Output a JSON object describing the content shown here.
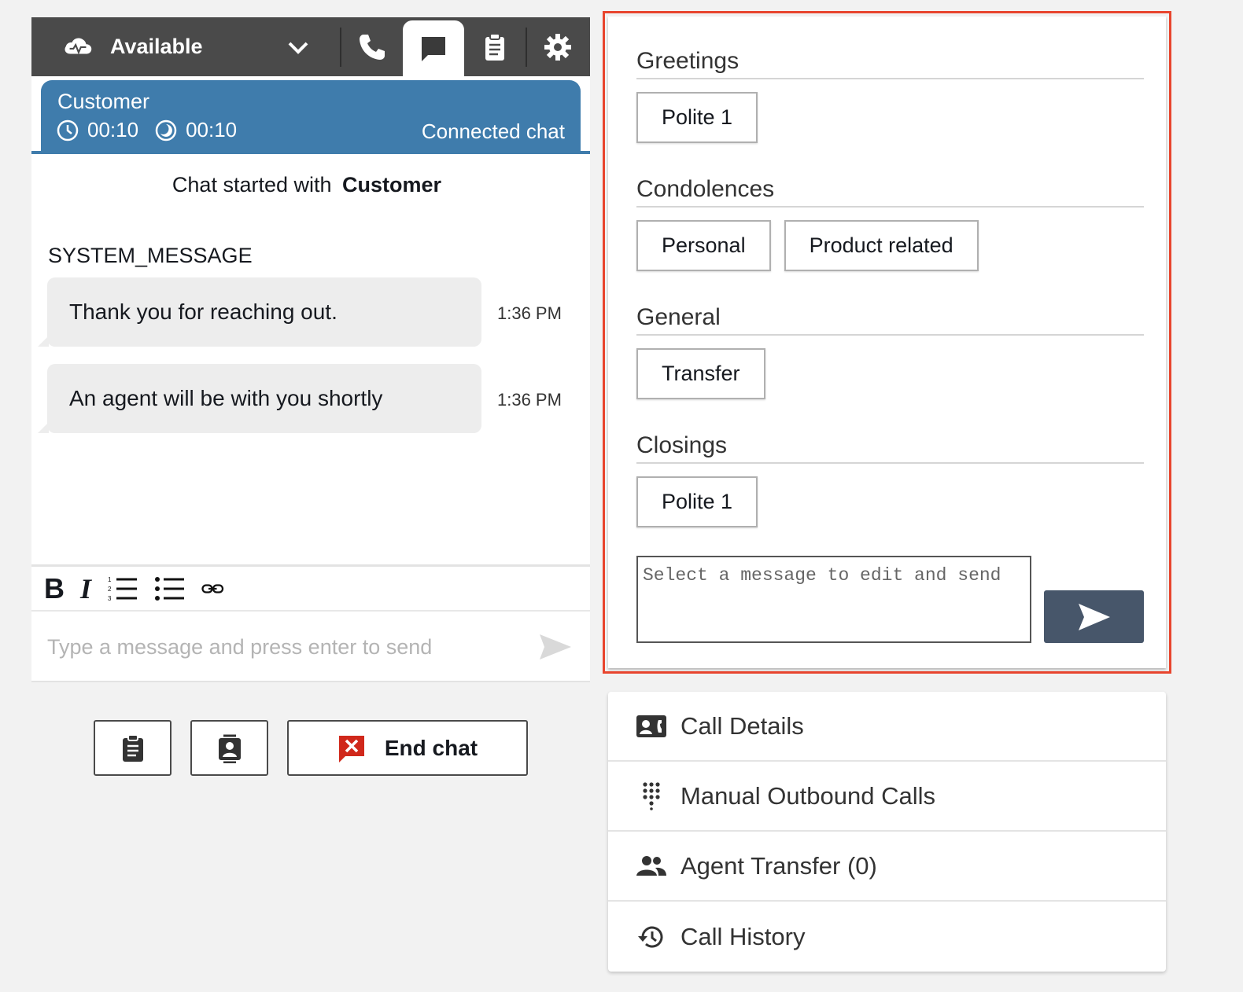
{
  "topbar": {
    "status_label": "Available",
    "tabs": [
      "phone-icon",
      "chat-icon",
      "clipboard-icon",
      "gear-icon"
    ]
  },
  "contact": {
    "name": "Customer",
    "timer1": "00:10",
    "timer2": "00:10",
    "state": "Connected chat"
  },
  "transcript": {
    "started_prefix": "Chat started with",
    "started_name": "Customer",
    "sender": "SYSTEM_MESSAGE",
    "messages": [
      {
        "text": "Thank you for reaching out.",
        "time": "1:36 PM"
      },
      {
        "text": "An agent will be with you shortly",
        "time": "1:36 PM"
      }
    ]
  },
  "composer": {
    "placeholder": "Type a message and press enter to send"
  },
  "actions": {
    "end_label": "End chat"
  },
  "quick_responses": {
    "sections": [
      {
        "title": "Greetings",
        "buttons": [
          "Polite 1"
        ]
      },
      {
        "title": "Condolences",
        "buttons": [
          "Personal",
          "Product related"
        ]
      },
      {
        "title": "General",
        "buttons": [
          "Transfer"
        ]
      },
      {
        "title": "Closings",
        "buttons": [
          "Polite 1"
        ]
      }
    ],
    "edit_placeholder": "Select a message to edit and send"
  },
  "nav": {
    "items": [
      "Call Details",
      "Manual Outbound Calls",
      "Agent Transfer (0)",
      "Call History"
    ]
  },
  "colors": {
    "topbar": "#4a4a4a",
    "contact_tab": "#3f7cac",
    "highlight_border": "#e8452e",
    "send_button": "#47566a",
    "end_chat_icon": "#d0281b"
  }
}
